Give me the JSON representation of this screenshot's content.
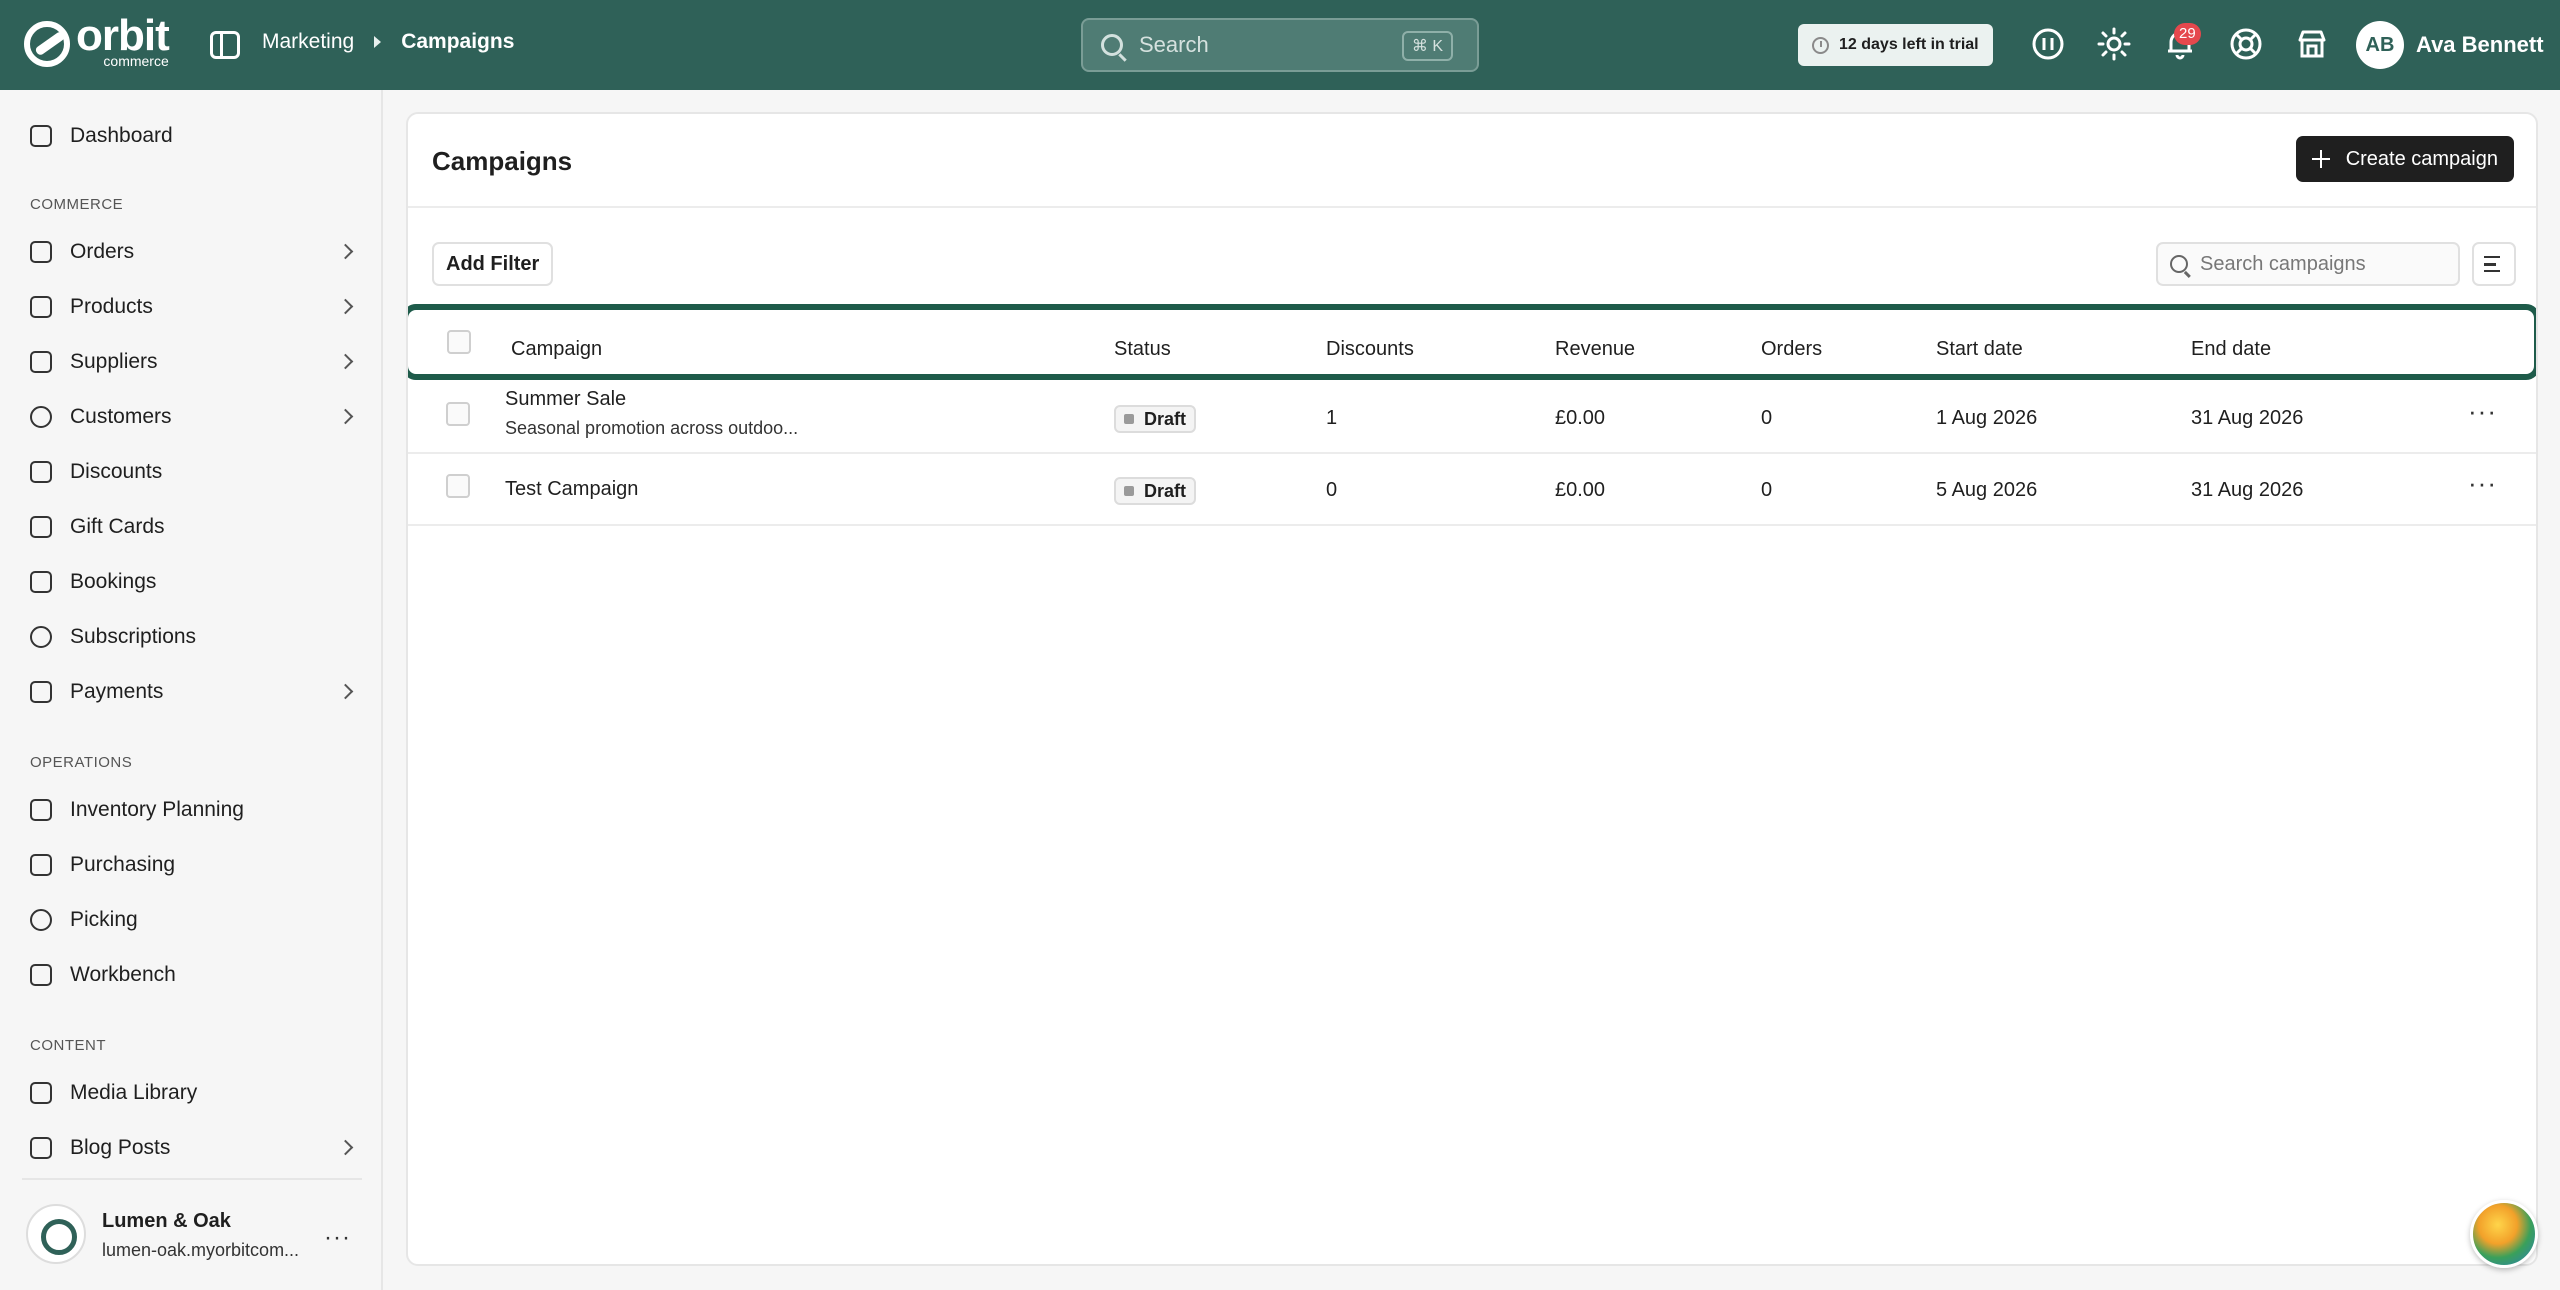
{
  "app": {
    "logo_text": "orbit",
    "logo_subtext": "commerce",
    "brand_color": "#2f6158"
  },
  "breadcrumb": [
    "Marketing",
    "Campaigns"
  ],
  "search": {
    "placeholder": "Search",
    "shortcut": "⌘ K"
  },
  "trial": {
    "label": "12 days left in trial"
  },
  "notifications": {
    "count": "29"
  },
  "user": {
    "initials": "AB",
    "name": "Ava Bennett"
  },
  "sidebar": {
    "top": [
      {
        "label": "Dashboard",
        "icon": "dashboard-icon"
      }
    ],
    "sections": [
      {
        "title": "COMMERCE",
        "items": [
          {
            "label": "Orders",
            "icon": "orders-icon",
            "chevron": true
          },
          {
            "label": "Products",
            "icon": "products-icon",
            "chevron": true
          },
          {
            "label": "Suppliers",
            "icon": "suppliers-icon",
            "chevron": true
          },
          {
            "label": "Customers",
            "icon": "customers-icon",
            "chevron": true
          },
          {
            "label": "Discounts",
            "icon": "tag-icon",
            "chevron": false
          },
          {
            "label": "Gift Cards",
            "icon": "gift-icon",
            "chevron": false
          },
          {
            "label": "Bookings",
            "icon": "calendar-icon",
            "chevron": false
          },
          {
            "label": "Subscriptions",
            "icon": "refresh-icon",
            "chevron": false
          },
          {
            "label": "Payments",
            "icon": "credit-card-icon",
            "chevron": true
          }
        ]
      },
      {
        "title": "OPERATIONS",
        "items": [
          {
            "label": "Inventory Planning",
            "icon": "clipboard-icon",
            "chevron": false
          },
          {
            "label": "Purchasing",
            "icon": "box-icon",
            "chevron": false
          },
          {
            "label": "Picking",
            "icon": "map-pin-icon",
            "chevron": false
          },
          {
            "label": "Workbench",
            "icon": "box-icon",
            "chevron": false
          }
        ]
      },
      {
        "title": "CONTENT",
        "items": [
          {
            "label": "Media Library",
            "icon": "image-icon",
            "chevron": false
          },
          {
            "label": "Blog Posts",
            "icon": "document-icon",
            "chevron": true
          }
        ]
      }
    ],
    "store": {
      "name": "Lumen & Oak",
      "url": "lumen-oak.myorbitcom..."
    }
  },
  "page": {
    "title": "Campaigns",
    "create_label": "Create campaign",
    "add_filter_label": "Add Filter",
    "search_placeholder": "Search campaigns"
  },
  "table": {
    "columns": [
      "Campaign",
      "Status",
      "Discounts",
      "Revenue",
      "Orders",
      "Start date",
      "End date"
    ],
    "rows": [
      {
        "campaign": "Summer Sale",
        "description": "Seasonal promotion across outdoo...",
        "status": "Draft",
        "discounts": "1",
        "revenue": "£0.00",
        "orders": "0",
        "start_date": "1 Aug 2026",
        "end_date": "31 Aug 2026"
      },
      {
        "campaign": "Test Campaign",
        "description": "",
        "status": "Draft",
        "discounts": "0",
        "revenue": "£0.00",
        "orders": "0",
        "start_date": "5 Aug 2026",
        "end_date": "31 Aug 2026"
      }
    ]
  }
}
